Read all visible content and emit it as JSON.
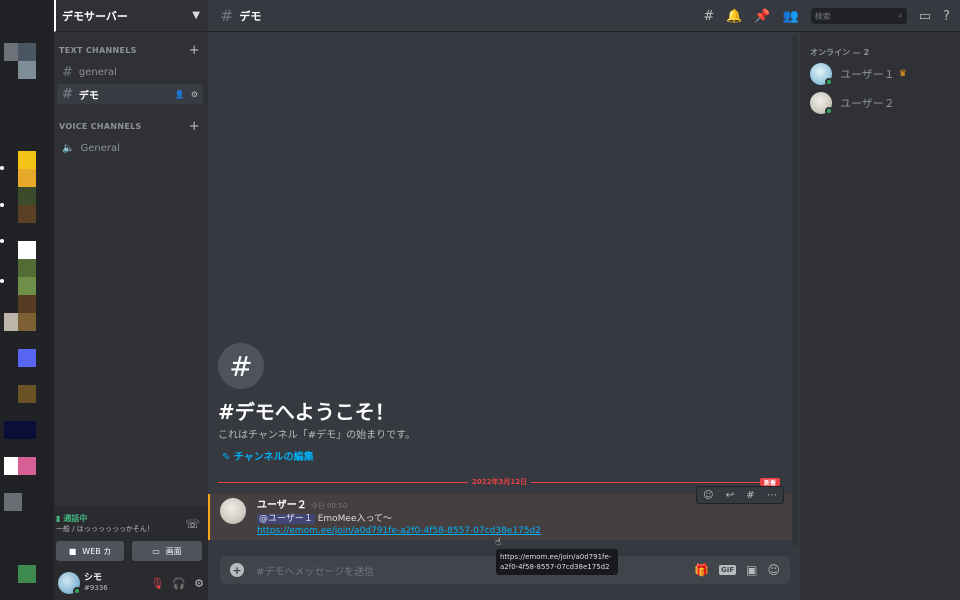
{
  "server": {
    "name": "デモサーバー"
  },
  "categories": {
    "text": "TEXT CHANNELS",
    "voice": "VOICE CHANNELS"
  },
  "text_channels": [
    {
      "name": "general"
    },
    {
      "name": "デモ"
    }
  ],
  "voice_channels": [
    {
      "name": "General"
    }
  ],
  "voice_panel": {
    "status": "通話中",
    "channel": "一般 / はっっっっっっかそん！",
    "web_camera": "WEB カ",
    "screen": "画面"
  },
  "user": {
    "name": "シモ",
    "tag": "#9336"
  },
  "topbar": {
    "title": "デモ",
    "search_placeholder": "検索"
  },
  "welcome": {
    "title": "#デモへようこそ！",
    "subtitle": "これはチャンネル「#デモ」の始まりです。",
    "edit": "チャンネルの編集"
  },
  "divider": {
    "date": "2022年3月12日",
    "badge": "新着"
  },
  "message": {
    "author": "ユーザー２",
    "time": "今日 00:50",
    "mention": "@ユーザー１",
    "text": "EmoMee入って〜",
    "link": "https://emom.ee/join/a0d791fe-a2f0-4f58-8557-07cd38e175d2"
  },
  "tooltip": {
    "line1": "https://emom.ee/join/a0d791fe-",
    "line2": "a2f0-4f58-8557-07cd38e175d2"
  },
  "composer": {
    "placeholder": "#デモへメッセージを送信",
    "gif": "GIF"
  },
  "members": {
    "header": "オンライン — 2",
    "list": [
      {
        "name": "ユーザー１"
      },
      {
        "name": "ユーザー２"
      }
    ]
  },
  "colors": {
    "accent": "#5865f2",
    "online": "#3ba55d",
    "link": "#00b0f4",
    "new": "#ed4245",
    "highlight": "#faa61a"
  }
}
